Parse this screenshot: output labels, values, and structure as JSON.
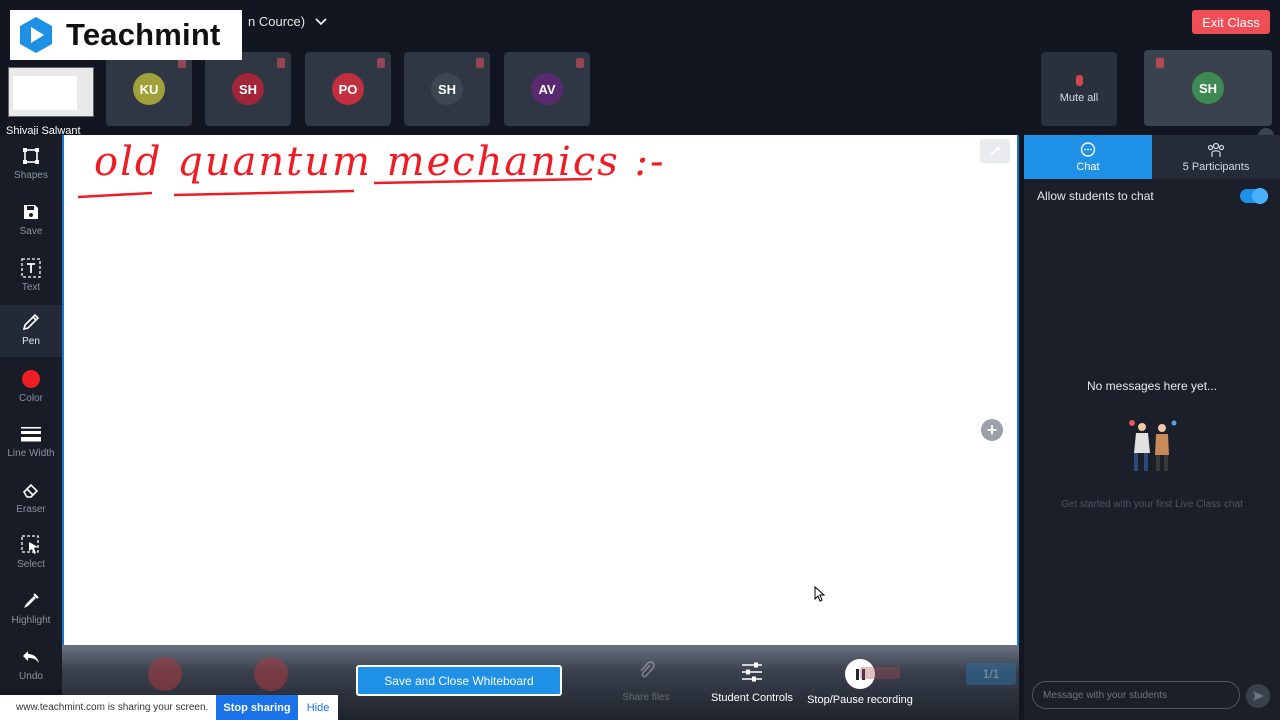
{
  "brand": {
    "name": "Teachmint",
    "color": "#1e90e5"
  },
  "header": {
    "class_title": "n Cource)",
    "exit_label": "Exit Class"
  },
  "self": {
    "name": "Shivaji Salwant"
  },
  "participants": [
    {
      "initials": "KU",
      "color": "#a0a13a"
    },
    {
      "initials": "SH",
      "color": "#a3253a"
    },
    {
      "initials": "PO",
      "color": "#c22f3f"
    },
    {
      "initials": "SH",
      "color": "#3c4752"
    },
    {
      "initials": "AV",
      "color": "#5a2a70"
    }
  ],
  "mute_all_label": "Mute all",
  "host": {
    "initials": "SH"
  },
  "toolbar": {
    "shapes": "Shapes",
    "save": "Save",
    "text": "Text",
    "pen": "Pen",
    "color": "Color",
    "line_width": "Line Width",
    "eraser": "Eraser",
    "select": "Select",
    "highlight": "Highlight",
    "undo": "Undo",
    "pen_color": "#ee1c25"
  },
  "whiteboard": {
    "handwriting": "old quantum mechanics :-"
  },
  "bottombar": {
    "save_close_label": "Save and Close Whiteboard",
    "share_files_label": "Share files",
    "student_controls_label": "Student Controls",
    "recording_label": "Stop/Pause recording",
    "page_indicator": "1/1"
  },
  "sharing_banner": {
    "message": "www.teachmint.com is sharing your screen.",
    "stop_label": "Stop sharing",
    "hide_label": "Hide"
  },
  "panel": {
    "chat_tab": "Chat",
    "participants_tab": "5 Participants",
    "allow_chat_label": "Allow students to chat",
    "allow_chat_on": true,
    "empty_title": "No messages here yet...",
    "empty_subtitle": "Get started with your first Live Class chat",
    "input_placeholder": "Message with your students"
  }
}
